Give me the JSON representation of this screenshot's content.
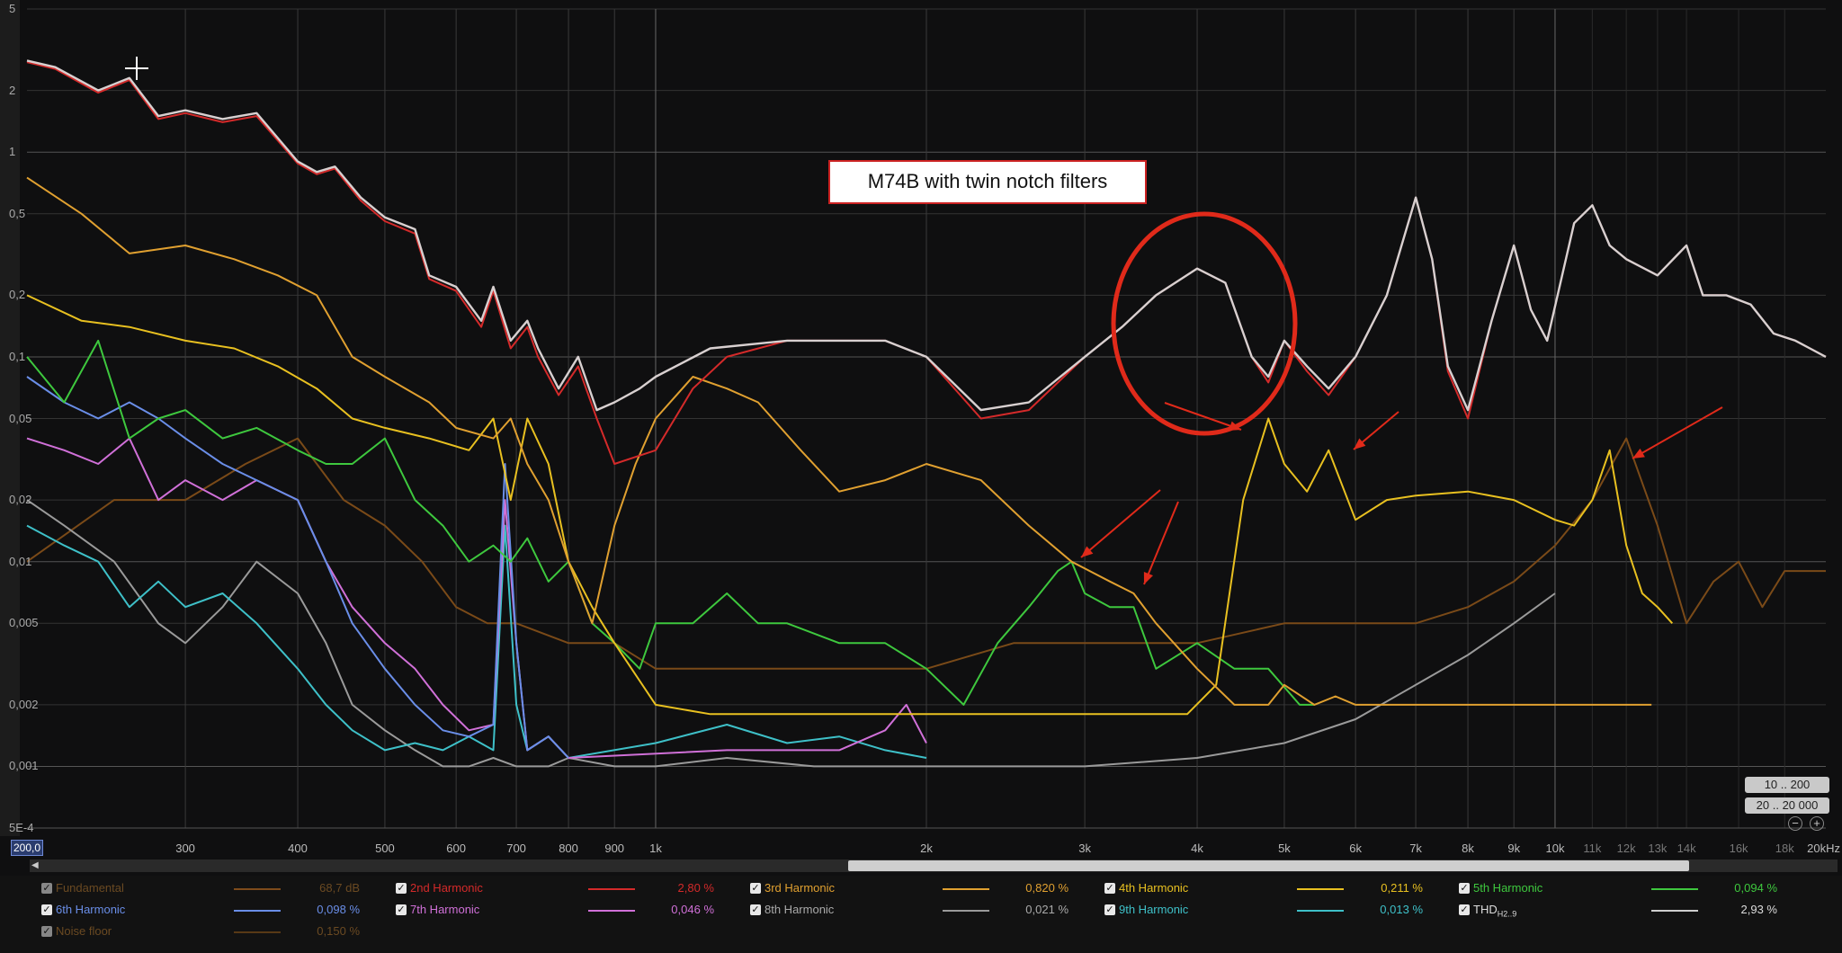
{
  "annotation": "M74B with twin notch filters",
  "y_axis": {
    "labels": [
      {
        "text": "5",
        "value": 5
      },
      {
        "text": "2",
        "value": 2
      },
      {
        "text": "1",
        "value": 1
      },
      {
        "text": "0,5",
        "value": 0.5
      },
      {
        "text": "0,2",
        "value": 0.2
      },
      {
        "text": "0,1",
        "value": 0.1
      },
      {
        "text": "0,05",
        "value": 0.05
      },
      {
        "text": "0,02",
        "value": 0.02
      },
      {
        "text": "0,01",
        "value": 0.01
      },
      {
        "text": "0,005",
        "value": 0.005
      },
      {
        "text": "0,002",
        "value": 0.002
      },
      {
        "text": "0,001",
        "value": 0.001
      },
      {
        "text": "5E-4",
        "value": 0.0005
      }
    ]
  },
  "x_axis": {
    "start": "200,0",
    "end": "20kHz",
    "labels": [
      {
        "text": "300",
        "value": 300,
        "major": true
      },
      {
        "text": "400",
        "value": 400,
        "major": true
      },
      {
        "text": "500",
        "value": 500,
        "major": true
      },
      {
        "text": "600",
        "value": 600,
        "major": true
      },
      {
        "text": "700",
        "value": 700,
        "major": true
      },
      {
        "text": "800",
        "value": 800,
        "major": true
      },
      {
        "text": "900",
        "value": 900,
        "major": true
      },
      {
        "text": "1k",
        "value": 1000,
        "major": true
      },
      {
        "text": "2k",
        "value": 2000,
        "major": true
      },
      {
        "text": "3k",
        "value": 3000,
        "major": true
      },
      {
        "text": "4k",
        "value": 4000,
        "major": true
      },
      {
        "text": "5k",
        "value": 5000,
        "major": true
      },
      {
        "text": "6k",
        "value": 6000,
        "major": true
      },
      {
        "text": "7k",
        "value": 7000,
        "major": true
      },
      {
        "text": "8k",
        "value": 8000,
        "major": true
      },
      {
        "text": "9k",
        "value": 9000,
        "major": true
      },
      {
        "text": "10k",
        "value": 10000,
        "major": true
      },
      {
        "text": "11k",
        "value": 11000,
        "major": false
      },
      {
        "text": "12k",
        "value": 12000,
        "major": false
      },
      {
        "text": "13k",
        "value": 13000,
        "major": false
      },
      {
        "text": "14k",
        "value": 14000,
        "major": false
      },
      {
        "text": "16k",
        "value": 16000,
        "major": false
      },
      {
        "text": "18k",
        "value": 18000,
        "major": false
      }
    ]
  },
  "range_buttons": {
    "btn1": "10 .. 200",
    "btn2": "20 .. 20 000"
  },
  "zoom": {
    "out": "−",
    "in": "+"
  },
  "legend": [
    {
      "name": "Fundamental",
      "value": "68,7 dB",
      "color": "#9a5a1e",
      "dim": true
    },
    {
      "name": "2nd Harmonic",
      "value": "2,80 %",
      "color": "#d42a2a",
      "dim": false
    },
    {
      "name": "3rd Harmonic",
      "value": "0,820 %",
      "color": "#e0a030",
      "dim": false
    },
    {
      "name": "4th Harmonic",
      "value": "0,211 %",
      "color": "#e8c020",
      "dim": false
    },
    {
      "name": "5th Harmonic",
      "value": "0,094 %",
      "color": "#3ec83e",
      "dim": false
    },
    {
      "name": "6th Harmonic",
      "value": "0,098 %",
      "color": "#6a8ee8",
      "dim": false
    },
    {
      "name": "7th Harmonic",
      "value": "0,046 %",
      "color": "#d070d8",
      "dim": false
    },
    {
      "name": "8th Harmonic",
      "value": "0,021 %",
      "color": "#9a9a9a",
      "dim": false
    },
    {
      "name": "9th Harmonic",
      "value": "0,013 %",
      "color": "#3ec0c8",
      "dim": false
    },
    {
      "name": "THD",
      "sub": "H2..9",
      "value": "2,93 %",
      "color": "#cfcfcf",
      "dim": false
    },
    {
      "name": "Noise floor",
      "value": "0,150 %",
      "color": "#6a4418",
      "dim": true
    }
  ],
  "chart_data": {
    "type": "line",
    "x_scale": "log",
    "y_scale": "log",
    "xlim": [
      200,
      20000
    ],
    "ylim": [
      0.0005,
      5
    ],
    "grid": true,
    "series": [
      {
        "name": "THD",
        "color": "#d8d0d0",
        "x": [
          200,
          215,
          240,
          260,
          280,
          300,
          330,
          360,
          400,
          420,
          440,
          470,
          500,
          540,
          560,
          600,
          640,
          660,
          690,
          720,
          740,
          780,
          820,
          860,
          900,
          960,
          1000,
          1150,
          1400,
          1800,
          2000,
          2300,
          2600,
          3000,
          3300,
          3600,
          4000,
          4300,
          4600,
          4800,
          5000,
          5300,
          5600,
          6000,
          6500,
          7000,
          7300,
          7600,
          8000,
          8500,
          9000,
          9400,
          9800,
          10500,
          11000,
          11500,
          12000,
          13000,
          14000,
          14600,
          15500,
          16500,
          17500,
          18500,
          19200,
          20000
        ],
        "y": [
          2.8,
          2.6,
          2.0,
          2.3,
          1.5,
          1.6,
          1.45,
          1.55,
          0.9,
          0.8,
          0.85,
          0.6,
          0.48,
          0.42,
          0.25,
          0.22,
          0.15,
          0.22,
          0.12,
          0.15,
          0.11,
          0.07,
          0.1,
          0.055,
          0.06,
          0.07,
          0.08,
          0.11,
          0.12,
          0.12,
          0.1,
          0.055,
          0.06,
          0.1,
          0.14,
          0.2,
          0.27,
          0.23,
          0.1,
          0.08,
          0.12,
          0.09,
          0.07,
          0.1,
          0.2,
          0.6,
          0.3,
          0.09,
          0.055,
          0.15,
          0.35,
          0.17,
          0.12,
          0.45,
          0.55,
          0.35,
          0.3,
          0.25,
          0.35,
          0.2,
          0.2,
          0.18,
          0.13,
          0.12,
          0.11,
          0.1
        ]
      },
      {
        "name": "2nd Harmonic",
        "color": "#d42a2a",
        "x": [
          200,
          215,
          240,
          260,
          280,
          300,
          330,
          360,
          400,
          420,
          440,
          470,
          500,
          540,
          560,
          600,
          640,
          660,
          690,
          720,
          740,
          780,
          820,
          860,
          900,
          1000,
          1100,
          1200,
          1400,
          1800,
          2000,
          2300,
          2600,
          3000,
          3300,
          3600,
          4000,
          4300,
          4600,
          4800,
          5000,
          5300,
          5600,
          6000,
          6500,
          7000,
          7300,
          7600,
          8000,
          8500,
          9000,
          9400,
          9800,
          10500,
          11000,
          11500,
          12000,
          13000,
          14000,
          14600,
          15500,
          16500,
          17500,
          18500,
          19200,
          20000
        ],
        "y": [
          2.75,
          2.55,
          1.95,
          2.25,
          1.45,
          1.55,
          1.4,
          1.5,
          0.88,
          0.78,
          0.83,
          0.58,
          0.46,
          0.4,
          0.24,
          0.21,
          0.14,
          0.21,
          0.11,
          0.14,
          0.1,
          0.065,
          0.09,
          0.05,
          0.03,
          0.035,
          0.07,
          0.1,
          0.12,
          0.12,
          0.1,
          0.05,
          0.055,
          0.1,
          0.14,
          0.2,
          0.27,
          0.23,
          0.1,
          0.075,
          0.12,
          0.085,
          0.065,
          0.1,
          0.2,
          0.6,
          0.3,
          0.085,
          0.05,
          0.15,
          0.35,
          0.17,
          0.12,
          0.45,
          0.55,
          0.35,
          0.3,
          0.25,
          0.35,
          0.2,
          0.2,
          0.18,
          0.13,
          0.12,
          0.11,
          0.1
        ]
      },
      {
        "name": "3rd Harmonic",
        "color": "#e0a030",
        "x": [
          200,
          230,
          260,
          300,
          340,
          380,
          420,
          460,
          500,
          560,
          600,
          660,
          690,
          720,
          760,
          800,
          850,
          900,
          950,
          1000,
          1100,
          1200,
          1300,
          1450,
          1600,
          1800,
          2000,
          2300,
          2600,
          2900,
          3200,
          3400,
          3600,
          4000,
          4400,
          4800,
          5000,
          5400,
          5700,
          6000,
          7000,
          8000,
          9000,
          10000,
          11000,
          12000,
          12800
        ],
        "y": [
          0.75,
          0.5,
          0.32,
          0.35,
          0.3,
          0.25,
          0.2,
          0.1,
          0.08,
          0.06,
          0.045,
          0.04,
          0.05,
          0.03,
          0.02,
          0.01,
          0.005,
          0.015,
          0.03,
          0.05,
          0.08,
          0.07,
          0.06,
          0.035,
          0.022,
          0.025,
          0.03,
          0.025,
          0.015,
          0.01,
          0.008,
          0.007,
          0.005,
          0.003,
          0.002,
          0.002,
          0.0025,
          0.002,
          0.0022,
          0.002,
          0.002,
          0.002,
          0.002,
          0.002,
          0.002,
          0.002,
          0.002
        ]
      },
      {
        "name": "4th Harmonic",
        "color": "#e8c020",
        "x": [
          200,
          230,
          260,
          300,
          340,
          380,
          420,
          460,
          500,
          560,
          620,
          660,
          690,
          720,
          760,
          800,
          850,
          900,
          1000,
          1150,
          1300,
          1500,
          1700,
          2000,
          2300,
          2600,
          2900,
          3100,
          3300,
          3600,
          3900,
          4200,
          4500,
          4800,
          5000,
          5300,
          5600,
          6000,
          6500,
          7000,
          8000,
          9000,
          10000,
          10500,
          11000,
          11500,
          12000,
          12500,
          13000,
          13500
        ],
        "y": [
          0.2,
          0.15,
          0.14,
          0.12,
          0.11,
          0.09,
          0.07,
          0.05,
          0.045,
          0.04,
          0.035,
          0.05,
          0.02,
          0.05,
          0.03,
          0.01,
          0.006,
          0.004,
          0.002,
          0.0018,
          0.0018,
          0.0018,
          0.0018,
          0.0018,
          0.0018,
          0.0018,
          0.0018,
          0.0018,
          0.0018,
          0.0018,
          0.0018,
          0.0025,
          0.02,
          0.05,
          0.03,
          0.022,
          0.035,
          0.016,
          0.02,
          0.021,
          0.022,
          0.02,
          0.016,
          0.015,
          0.02,
          0.035,
          0.012,
          0.007,
          0.006,
          0.005
        ]
      },
      {
        "name": "5th Harmonic",
        "color": "#3ec83e",
        "x": [
          200,
          220,
          240,
          260,
          280,
          300,
          330,
          360,
          400,
          430,
          460,
          500,
          540,
          580,
          620,
          660,
          690,
          720,
          760,
          800,
          850,
          900,
          960,
          1000,
          1100,
          1200,
          1300,
          1400,
          1600,
          1800,
          2000,
          2200,
          2400,
          2600,
          2800,
          2900,
          3000,
          3200,
          3400,
          3600,
          4000,
          4400,
          4800,
          5200,
          5400
        ],
        "y": [
          0.1,
          0.06,
          0.12,
          0.04,
          0.05,
          0.055,
          0.04,
          0.045,
          0.035,
          0.03,
          0.03,
          0.04,
          0.02,
          0.015,
          0.01,
          0.012,
          0.01,
          0.013,
          0.008,
          0.01,
          0.005,
          0.004,
          0.003,
          0.005,
          0.005,
          0.007,
          0.005,
          0.005,
          0.004,
          0.004,
          0.003,
          0.002,
          0.004,
          0.006,
          0.009,
          0.01,
          0.007,
          0.006,
          0.006,
          0.003,
          0.004,
          0.003,
          0.003,
          0.002,
          0.002
        ]
      },
      {
        "name": "6th Harmonic",
        "color": "#6a8ee8",
        "x": [
          200,
          220,
          240,
          260,
          280,
          300,
          330,
          360,
          400,
          430,
          460,
          500,
          540,
          580,
          620,
          660,
          680,
          700,
          720,
          760,
          800
        ],
        "y": [
          0.08,
          0.06,
          0.05,
          0.06,
          0.05,
          0.04,
          0.03,
          0.025,
          0.02,
          0.01,
          0.005,
          0.003,
          0.002,
          0.0015,
          0.0014,
          0.0016,
          0.03,
          0.004,
          0.0012,
          0.0014,
          0.0011
        ]
      },
      {
        "name": "7th Harmonic",
        "color": "#d070d8",
        "x": [
          200,
          220,
          240,
          260,
          280,
          300,
          330,
          360,
          400,
          430,
          460,
          500,
          540,
          580,
          620,
          660,
          680,
          700,
          720,
          760,
          800,
          1200,
          1400,
          1600,
          1800,
          1900,
          2000
        ],
        "y": [
          0.04,
          0.035,
          0.03,
          0.04,
          0.02,
          0.025,
          0.02,
          0.025,
          0.02,
          0.01,
          0.006,
          0.004,
          0.003,
          0.002,
          0.0015,
          0.0016,
          0.02,
          0.004,
          0.0012,
          0.0014,
          0.0011,
          0.0012,
          0.0012,
          0.0012,
          0.0015,
          0.002,
          0.0013
        ]
      },
      {
        "name": "8th Harmonic",
        "color": "#9a9a9a",
        "x": [
          200,
          220,
          250,
          280,
          300,
          330,
          360,
          400,
          430,
          460,
          500,
          540,
          580,
          620,
          660,
          700,
          760,
          800,
          900,
          1000,
          1200,
          1500,
          2000,
          3000,
          4000,
          5000,
          6000,
          7000,
          8000,
          9000,
          10000
        ],
        "y": [
          0.02,
          0.015,
          0.01,
          0.005,
          0.004,
          0.006,
          0.01,
          0.007,
          0.004,
          0.002,
          0.0015,
          0.0012,
          0.001,
          0.001,
          0.0011,
          0.001,
          0.001,
          0.0011,
          0.001,
          0.001,
          0.0011,
          0.001,
          0.001,
          0.001,
          0.0011,
          0.0013,
          0.0017,
          0.0025,
          0.0035,
          0.005,
          0.007
        ]
      },
      {
        "name": "9th Harmonic",
        "color": "#3ec0c8",
        "x": [
          200,
          220,
          240,
          260,
          280,
          300,
          330,
          360,
          400,
          430,
          460,
          500,
          540,
          580,
          620,
          660,
          680,
          700,
          720,
          760,
          800,
          1000,
          1200,
          1400,
          1600,
          1800,
          2000
        ],
        "y": [
          0.015,
          0.012,
          0.01,
          0.006,
          0.008,
          0.006,
          0.007,
          0.005,
          0.003,
          0.002,
          0.0015,
          0.0012,
          0.0013,
          0.0012,
          0.0014,
          0.0012,
          0.015,
          0.002,
          0.0012,
          0.0014,
          0.0011,
          0.0013,
          0.0016,
          0.0013,
          0.0014,
          0.0012,
          0.0011
        ]
      },
      {
        "name": "Noise floor",
        "color": "#7a4a18",
        "x": [
          200,
          250,
          300,
          350,
          400,
          450,
          500,
          550,
          600,
          650,
          700,
          800,
          900,
          1000,
          1200,
          1500,
          2000,
          2500,
          3000,
          3500,
          4000,
          5000,
          6000,
          7000,
          8000,
          9000,
          10000,
          11000,
          12000,
          13000,
          14000,
          15000,
          16000,
          17000,
          18000,
          19000,
          20000
        ],
        "y": [
          0.01,
          0.02,
          0.02,
          0.03,
          0.04,
          0.02,
          0.015,
          0.01,
          0.006,
          0.005,
          0.005,
          0.004,
          0.004,
          0.003,
          0.003,
          0.003,
          0.003,
          0.004,
          0.004,
          0.004,
          0.004,
          0.005,
          0.005,
          0.005,
          0.006,
          0.008,
          0.012,
          0.02,
          0.04,
          0.015,
          0.005,
          0.008,
          0.01,
          0.006,
          0.009,
          0.009,
          0.009
        ]
      }
    ]
  }
}
